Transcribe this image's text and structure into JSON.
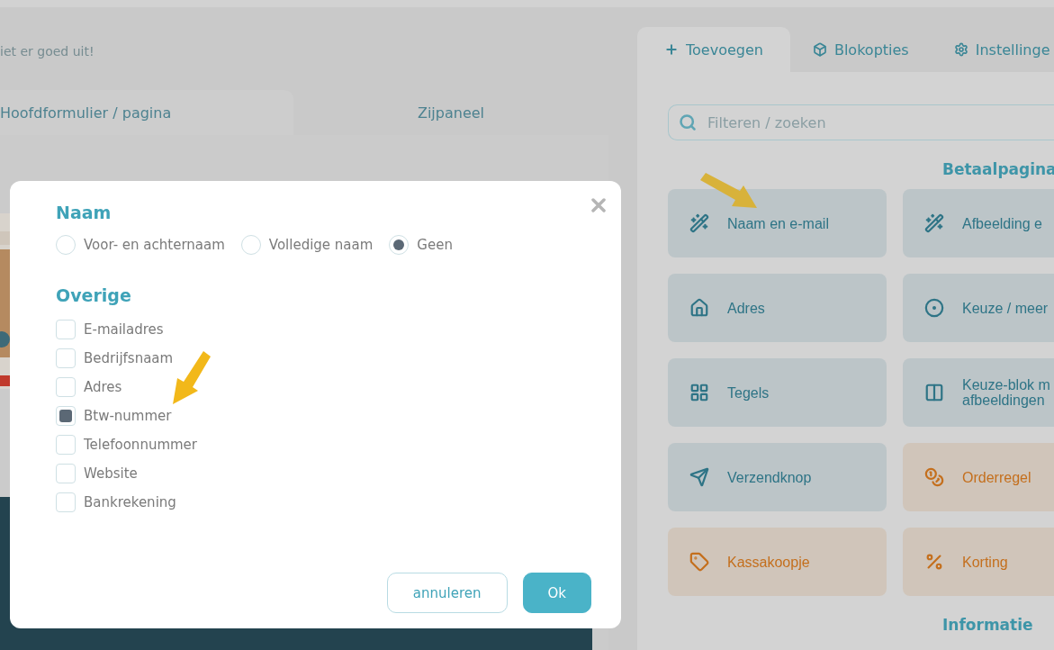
{
  "background_page": {
    "intro_text": "iet er goed uit!",
    "tabs": [
      {
        "label": "Hoofdformulier / pagina",
        "selected": true
      },
      {
        "label": "Zijpaneel",
        "selected": false
      }
    ]
  },
  "dialog": {
    "sections": [
      {
        "kind": "radio",
        "title": "Naam",
        "options": [
          {
            "label": "Voor- en achternaam",
            "selected": false
          },
          {
            "label": "Volledige naam",
            "selected": false
          },
          {
            "label": "Geen",
            "selected": true
          }
        ]
      },
      {
        "kind": "checkbox",
        "title": "Overige",
        "options": [
          {
            "label": "E-mailadres",
            "checked": false
          },
          {
            "label": "Bedrijfsnaam",
            "checked": false
          },
          {
            "label": "Adres",
            "checked": false
          },
          {
            "label": "Btw-nummer",
            "checked": true
          },
          {
            "label": "Telefoonnummer",
            "checked": false
          },
          {
            "label": "Website",
            "checked": false
          },
          {
            "label": "Bankrekening",
            "checked": false
          }
        ]
      }
    ],
    "buttons": [
      {
        "label": "annuleren",
        "kind": "secondary"
      },
      {
        "label": "Ok",
        "kind": "primary"
      }
    ]
  },
  "sidebar": {
    "tabs": [
      {
        "label": "Toevoegen",
        "kind": "plus",
        "selected": true
      },
      {
        "label": "Blokopties",
        "kind": "cube",
        "selected": false
      },
      {
        "label": "Instellinge",
        "kind": "gear",
        "selected": false
      }
    ],
    "search": {
      "placeholder": "Filteren / zoeken"
    },
    "sections": [
      {
        "title": "Betaalpagina",
        "tiles": [
          {
            "label": "Naam en e-mail",
            "kind": "wand",
            "color": "#2e7486"
          },
          {
            "label": "Afbeelding e",
            "kind": "wand",
            "color": "#2e7486"
          },
          {
            "label": "Adres",
            "kind": "house",
            "color": "#2e7486"
          },
          {
            "label": "Keuze / meer",
            "kind": "target",
            "color": "#2e7486"
          },
          {
            "label": "Tegels",
            "kind": "grid",
            "color": "#2e7486"
          },
          {
            "label": "Keuze-blok m\nafbeeldingen",
            "kind": "columns",
            "color": "#2e7486"
          },
          {
            "label": "Verzendknop",
            "kind": "send",
            "color": "#2e7486"
          },
          {
            "label": "Orderregel",
            "kind": "coins",
            "color": "#c46f1d"
          },
          {
            "label": "Kassakoopje",
            "kind": "tag",
            "color": "#c46f1d"
          },
          {
            "label": "Korting",
            "kind": "percent",
            "color": "#c46f1d"
          }
        ]
      },
      {
        "title": "Informatie"
      }
    ]
  }
}
